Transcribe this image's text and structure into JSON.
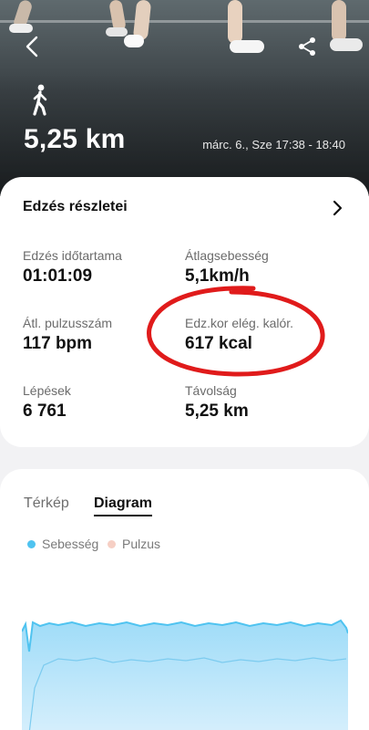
{
  "hero": {
    "distance": "5,25 km",
    "datetime": "márc. 6., Sze 17:38 - 18:40"
  },
  "details": {
    "title": "Edzés részletei",
    "stats": [
      {
        "label": "Edzés időtartama",
        "value": "01:01:09",
        "unit": ""
      },
      {
        "label": "Átlagsebesség",
        "value": "5,1",
        "unit": "km/h"
      },
      {
        "label": "Átl. pulzusszám",
        "value": "117",
        "unit": "bpm"
      },
      {
        "label": "Edz.kor elég. kalór.",
        "value": "617",
        "unit": "kcal"
      },
      {
        "label": "Lépések",
        "value": "6 761",
        "unit": ""
      },
      {
        "label": "Távolság",
        "value": "5,25",
        "unit": "km"
      }
    ]
  },
  "chart_section": {
    "tabs": [
      "Térkép",
      "Diagram"
    ],
    "active_tab": "Diagram",
    "legend": [
      {
        "name": "Sebesség",
        "color": "#4fc3f0"
      },
      {
        "name": "Pulzus",
        "color": "#f6cfc4"
      }
    ]
  },
  "icons": {
    "back": "back-arrow-icon",
    "share": "share-icon",
    "activity": "walking-person-icon",
    "chevron": "chevron-right-icon"
  },
  "colors": {
    "speed": "#4fc3f0",
    "speed_fill": "#bfe6fb",
    "heart_rate": "#f6cfc4",
    "annotation": "#e01b1b"
  }
}
